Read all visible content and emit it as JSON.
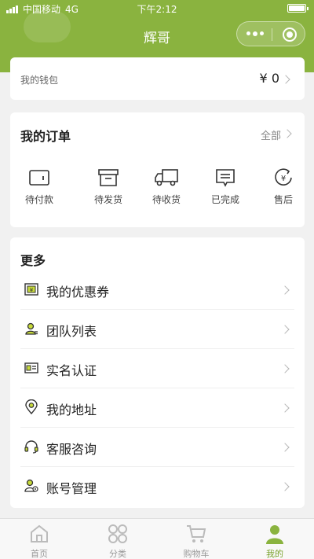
{
  "status_bar": {
    "carrier": "中国移动",
    "network": "4G",
    "time": "下午2:12"
  },
  "nav": {
    "title": "辉哥"
  },
  "wallet": {
    "label": "我的钱包",
    "value": "¥ 0"
  },
  "orders": {
    "title": "我的订单",
    "all_label": "全部",
    "items": [
      {
        "label": "待付款",
        "icon": "wallet-icon"
      },
      {
        "label": "待发货",
        "icon": "box-icon"
      },
      {
        "label": "待收货",
        "icon": "truck-icon"
      },
      {
        "label": "已完成",
        "icon": "message-icon"
      },
      {
        "label": "售后",
        "icon": "refund-icon"
      }
    ]
  },
  "more": {
    "title": "更多",
    "items": [
      {
        "label": "我的优惠券",
        "icon": "coupon-icon"
      },
      {
        "label": "团队列表",
        "icon": "team-icon"
      },
      {
        "label": "实名认证",
        "icon": "id-card-icon"
      },
      {
        "label": "我的地址",
        "icon": "location-icon"
      },
      {
        "label": "客服咨询",
        "icon": "headset-icon"
      },
      {
        "label": "账号管理",
        "icon": "account-manage-icon"
      }
    ]
  },
  "tabbar": {
    "items": [
      {
        "label": "首页",
        "icon": "home-icon",
        "active": false
      },
      {
        "label": "分类",
        "icon": "category-icon",
        "active": false
      },
      {
        "label": "购物车",
        "icon": "cart-icon",
        "active": false
      },
      {
        "label": "我的",
        "icon": "profile-icon",
        "active": true
      }
    ]
  },
  "colors": {
    "brand": "#8ab33f",
    "active_tab": "#7aa32d",
    "background": "#f1f1f1"
  }
}
